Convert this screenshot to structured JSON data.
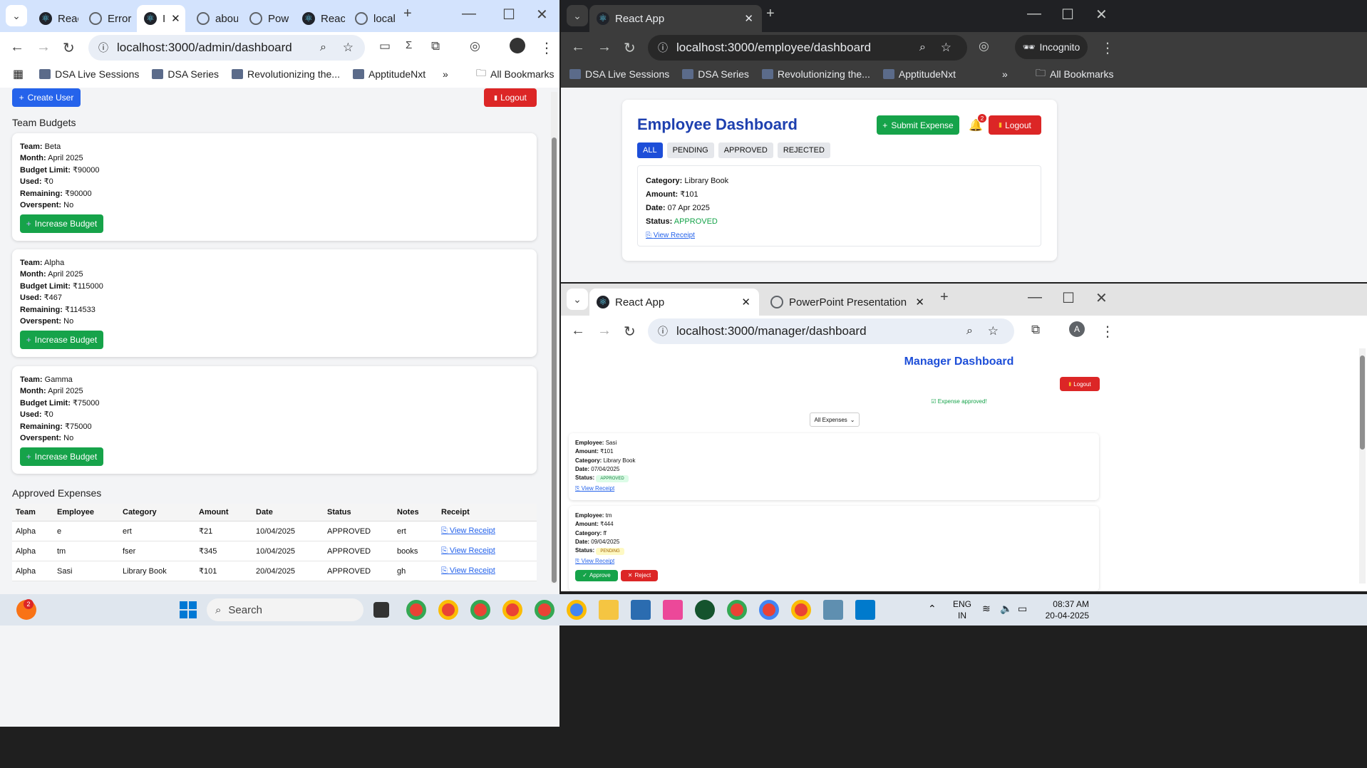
{
  "left_window": {
    "tabs": [
      "Reac",
      "Error",
      "I",
      "abou",
      "Pow",
      "Reac",
      "local"
    ],
    "url": "localhost:3000/admin/dashboard",
    "bookmarks": [
      "DSA Live Sessions",
      "DSA Series",
      "Revolutionizing the...",
      "ApptitudeNxt"
    ],
    "all_bookmarks": "All Bookmarks",
    "create_user": "Create User",
    "logout": "Logout",
    "team_budgets_title": "Team Budgets",
    "labels": {
      "team": "Team:",
      "month": "Month:",
      "limit": "Budget Limit:",
      "used": "Used:",
      "remaining": "Remaining:",
      "overspent": "Overspent:"
    },
    "budgets": [
      {
        "team": "Beta",
        "month": "April 2025",
        "limit": "₹90000",
        "used": "₹0",
        "remaining": "₹90000",
        "overspent": "No",
        "button": "Increase Budget"
      },
      {
        "team": "Alpha",
        "month": "April 2025",
        "limit": "₹115000",
        "used": "₹467",
        "remaining": "₹114533",
        "overspent": "No",
        "button": "Increase Budget"
      },
      {
        "team": "Gamma",
        "month": "April 2025",
        "limit": "₹75000",
        "used": "₹0",
        "remaining": "₹75000",
        "overspent": "No",
        "button": "Increase Budget"
      }
    ],
    "approved_title": "Approved Expenses",
    "table_headers": [
      "Team",
      "Employee",
      "Category",
      "Amount",
      "Date",
      "Status",
      "Notes",
      "Receipt"
    ],
    "table_rows": [
      [
        "Alpha",
        "e",
        "ert",
        "₹21",
        "10/04/2025",
        "APPROVED",
        "ert",
        "View Receipt"
      ],
      [
        "Alpha",
        "tm",
        "fser",
        "₹345",
        "10/04/2025",
        "APPROVED",
        "books",
        "View Receipt"
      ],
      [
        "Alpha",
        "Sasi",
        "Library Book",
        "₹101",
        "20/04/2025",
        "APPROVED",
        "gh",
        "View Receipt"
      ]
    ]
  },
  "right_top_window": {
    "tab": "React App",
    "url": "localhost:3000/employee/dashboard",
    "incognito": "Incognito",
    "bookmarks": [
      "DSA Live Sessions",
      "DSA Series",
      "Revolutionizing the...",
      "ApptitudeNxt"
    ],
    "all_bookmarks": "All Bookmarks",
    "title": "Employee Dashboard",
    "submit_expense": "Submit Expense",
    "notification_count": "2",
    "logout": "Logout",
    "filters": [
      "ALL",
      "PENDING",
      "APPROVED",
      "REJECTED"
    ],
    "expense": {
      "category_label": "Category:",
      "category": "Library Book",
      "amount_label": "Amount:",
      "amount": "₹101",
      "date_label": "Date:",
      "date": "07 Apr 2025",
      "status_label": "Status:",
      "status": "APPROVED",
      "receipt": "View Receipt"
    }
  },
  "right_bottom_window": {
    "tabs": [
      "React App",
      "PowerPoint Presentation"
    ],
    "url": "localhost:3000/manager/dashboard",
    "avatar": "A",
    "title": "Manager Dashboard",
    "logout": "Logout",
    "toast": "Expense approved!",
    "filter": "All Expenses",
    "labels": {
      "employee": "Employee:",
      "amount": "Amount:",
      "category": "Category:",
      "date": "Date:",
      "status": "Status:"
    },
    "expenses": [
      {
        "employee": "Sasi",
        "amount": "₹101",
        "category": "Library Book",
        "date": "07/04/2025",
        "status": "APPROVED",
        "receipt": "View Receipt"
      },
      {
        "employee": "tm",
        "amount": "₹444",
        "category": "ff",
        "date": "09/04/2025",
        "status": "PENDING",
        "receipt": "View Receipt"
      }
    ],
    "approve": "Approve",
    "reject": "Reject"
  },
  "taskbar": {
    "search": "Search",
    "badge": "2",
    "lang": "ENG",
    "region": "IN",
    "time": "08:37 AM",
    "date": "20-04-2025"
  },
  "colors": {
    "primary_blue": "#2563eb",
    "danger_red": "#dc2626",
    "success_green": "#16a34a"
  }
}
